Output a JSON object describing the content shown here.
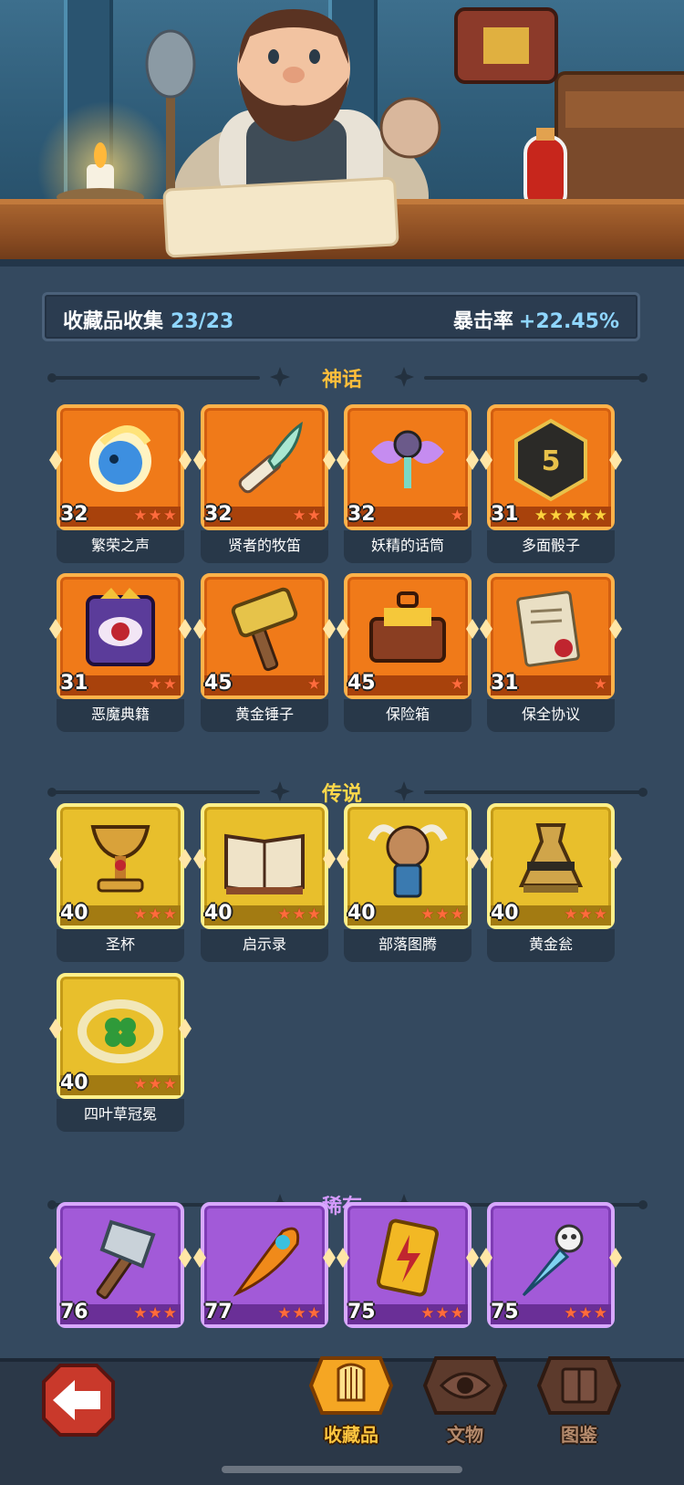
{
  "collection": {
    "label": "收藏品收集",
    "count": "23/23",
    "crit_label": "暴击率",
    "crit_value": "+22.45%"
  },
  "sections": {
    "mythic": {
      "title": "神话",
      "items": [
        {
          "level": "32",
          "stars": 3,
          "star_color": "red",
          "name": "繁荣之声",
          "icon": "blue-spirit-orb-icon"
        },
        {
          "level": "32",
          "stars": 2,
          "star_color": "red",
          "name": "贤者的牧笛",
          "icon": "feather-flute-icon"
        },
        {
          "level": "32",
          "stars": 1,
          "star_color": "red",
          "name": "妖精的话筒",
          "icon": "fairy-microphone-icon"
        },
        {
          "level": "31",
          "stars": 5,
          "star_color": "gold",
          "name": "多面骰子",
          "icon": "polyhedral-dice-icon"
        },
        {
          "level": "31",
          "stars": 2,
          "star_color": "red",
          "name": "恶魔典籍",
          "icon": "demon-eye-book-icon"
        },
        {
          "level": "45",
          "stars": 1,
          "star_color": "red",
          "name": "黄金锤子",
          "icon": "golden-hammer-icon"
        },
        {
          "level": "45",
          "stars": 1,
          "star_color": "red",
          "name": "保险箱",
          "icon": "treasure-chest-icon"
        },
        {
          "level": "31",
          "stars": 1,
          "star_color": "red",
          "name": "保全协议",
          "icon": "sealed-scroll-icon"
        }
      ]
    },
    "legend": {
      "title": "传说",
      "items": [
        {
          "level": "40",
          "stars": 3,
          "star_color": "red",
          "name": "圣杯",
          "icon": "holy-grail-icon"
        },
        {
          "level": "40",
          "stars": 3,
          "star_color": "red",
          "name": "启示录",
          "icon": "open-book-icon"
        },
        {
          "level": "40",
          "stars": 3,
          "star_color": "red",
          "name": "部落图腾",
          "icon": "bull-totem-icon"
        },
        {
          "level": "40",
          "stars": 3,
          "star_color": "red",
          "name": "黄金瓮",
          "icon": "golden-urn-icon"
        },
        {
          "level": "40",
          "stars": 3,
          "star_color": "red",
          "name": "四叶草冠冕",
          "icon": "clover-crown-icon"
        }
      ]
    },
    "rare": {
      "title": "稀有",
      "items": [
        {
          "level": "76",
          "stars": 3,
          "star_color": "red",
          "icon": "axe-icon"
        },
        {
          "level": "77",
          "stars": 3,
          "star_color": "red",
          "icon": "phoenix-feather-icon"
        },
        {
          "level": "75",
          "stars": 3,
          "star_color": "red",
          "icon": "lightning-card-icon"
        },
        {
          "level": "75",
          "stars": 3,
          "star_color": "red",
          "icon": "ice-skull-dagger-icon"
        }
      ]
    }
  },
  "nav": {
    "back_icon": "back-arrow-icon",
    "tabs": [
      {
        "label": "收藏品",
        "active": true,
        "icon": "harp-icon"
      },
      {
        "label": "文物",
        "active": false,
        "icon": "eye-icon"
      },
      {
        "label": "图鉴",
        "active": false,
        "icon": "book-icon"
      }
    ]
  },
  "colors": {
    "background": "#34495f",
    "mythic_frame": "#f07a19",
    "legend_frame": "#e8bf2c",
    "rare_frame": "#a25ad8",
    "accent_blue": "#8fd6ff",
    "active_tab": "#ffc640"
  }
}
